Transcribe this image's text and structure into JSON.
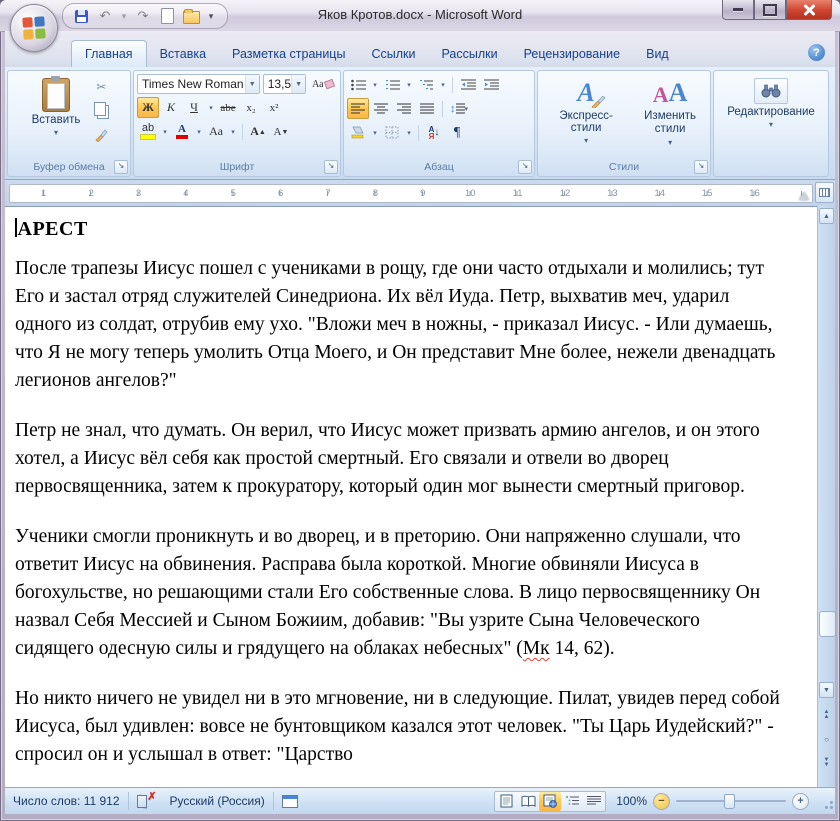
{
  "window": {
    "title": "Яков Кротов.docx - Microsoft Word"
  },
  "icons": {
    "dropdown": "▾",
    "combo_arrow": "▼",
    "scissors": "✂",
    "pilcrow": "¶",
    "undo": "↶",
    "redo": "↷",
    "help": "?",
    "launcher": "↘",
    "sort_a": "А",
    "sort_z": "Я",
    "arrow_down": "↓",
    "line_spacing": "↕",
    "up_arrow": "▲",
    "down_arrow": "▼",
    "ball": "○",
    "minus": "−",
    "plus": "+",
    "caret_up": "▲",
    "caret_down": "▼"
  },
  "tabs": {
    "items": [
      {
        "label": "Главная"
      },
      {
        "label": "Вставка"
      },
      {
        "label": "Разметка страницы"
      },
      {
        "label": "Ссылки"
      },
      {
        "label": "Рассылки"
      },
      {
        "label": "Рецензирование"
      },
      {
        "label": "Вид"
      }
    ],
    "active": "Главная"
  },
  "ribbon": {
    "clipboard": {
      "paste": "Вставить",
      "group_label": "Буфер обмена"
    },
    "font": {
      "name": "Times New Roman",
      "size": "13,5",
      "bold": "Ж",
      "italic": "К",
      "underline": "Ч",
      "strikethrough": "abe",
      "subscript": "x₂",
      "superscript": "x²",
      "highlight": "ab",
      "font_color": "А",
      "change_case": "Аа",
      "grow": "А",
      "shrink": "А",
      "clear": "Аа",
      "group_label": "Шрифт"
    },
    "paragraph": {
      "group_label": "Абзац"
    },
    "styles": {
      "quick": "Экспресс-стили",
      "change": "Изменить стили",
      "group_label": "Стили"
    },
    "editing": {
      "label": "Редактирование"
    }
  },
  "ruler": {
    "numbers": [
      1,
      2,
      3,
      4,
      5,
      6,
      7,
      8,
      9,
      10,
      11,
      12,
      13,
      14,
      15,
      16
    ]
  },
  "document": {
    "heading": "АРЕСТ",
    "p1": "После трапезы Иисус пошел с учениками в рощу, где они часто отдыхали и молились; тут Его и застал отряд служителей Синедриона. Их вёл Иуда. Петр, выхватив меч, ударил одного из солдат, отрубив ему ухо. \"Вложи меч в ножны, - приказал Иисус. - Или думаешь, что Я не могу теперь умолить Отца Моего, и Он представит Мне более, нежели двенадцать легионов ангелов?\"",
    "p2": "Петр не знал, что думать. Он верил, что Иисус может призвать армию ангелов, и он этого хотел, а Иисус вёл себя как простой смертный. Его связали и отвели во дворец первосвященника, затем к прокуратору, который один мог вынести смертный приговор.",
    "p3_before": "Ученики смогли проникнуть и во дворец, и в преторию. Они напряженно слушали, что ответит Иисус на обвинения. Расправа была короткой. Многие обвиняли Иисуса в богохульстве, но решающими стали Его собственные слова. В лицо первосвященнику Он назвал Себя Мессией и Сыном Божиим, добавив: \"Вы узрите Сына Человеческого сидящего одесную силы и грядущего на облаках небесных\" (",
    "p3_misspelled": "Мк",
    "p3_after": " 14, 62).",
    "p4": "Но никто ничего не увидел ни в это мгновение, ни в следующие. Пилат, увидев перед собой Иисуса, был удивлен: вовсе не бунтовщиком казался этот человек. \"Ты Царь Иудейский?\" - спросил он и услышал в ответ:  \"Царство"
  },
  "status": {
    "word_count": "Число слов: 11 912",
    "language": "Русский (Россия)",
    "zoom": "100%"
  }
}
